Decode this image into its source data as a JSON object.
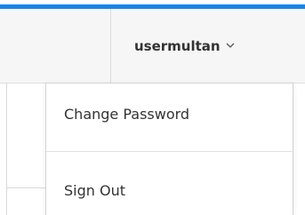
{
  "header": {
    "accent_color": "#1586e6",
    "user_menu": {
      "username": "usermultan",
      "icon": "chevron-down-icon"
    }
  },
  "dropdown": {
    "items": [
      {
        "label": "Change Password"
      },
      {
        "label": "Sign Out"
      }
    ]
  }
}
